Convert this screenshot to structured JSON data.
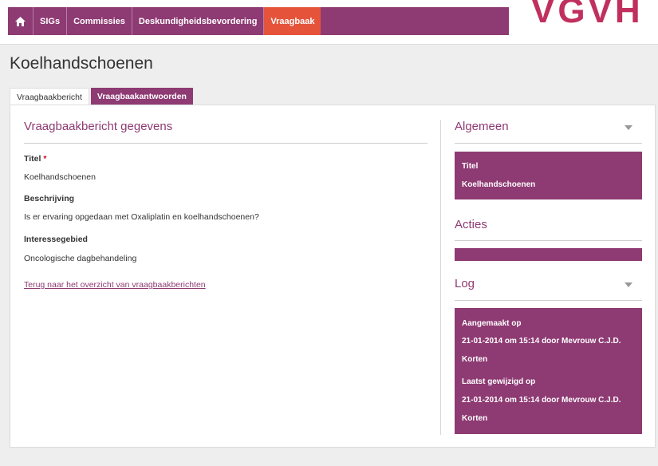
{
  "nav": {
    "items": [
      {
        "label": "SIGs"
      },
      {
        "label": "Commissies"
      },
      {
        "label": "Deskundigheidsbevordering"
      },
      {
        "label": "Vraagbaak"
      }
    ]
  },
  "logo": {
    "text": "VGVH"
  },
  "page": {
    "title": "Koelhandschoenen"
  },
  "tabs": [
    {
      "label": "Vraagbaakbericht"
    },
    {
      "label": "Vraagbaakantwoorden"
    }
  ],
  "details": {
    "section_title": "Vraagbaakbericht gegevens",
    "titel_label": "Titel",
    "required_marker": "*",
    "titel_value": "Koelhandschoenen",
    "beschrijving_label": "Beschrijving",
    "beschrijving_value": "Is er ervaring opgedaan met Oxaliplatin en koelhandschoenen?",
    "interesse_label": "Interessegebied",
    "interesse_value": "Oncologische dagbehandeling",
    "back_link": "Terug naar het overzicht van vraagbaakberichten"
  },
  "sidebar": {
    "algemeen": {
      "title": "Algemeen",
      "label": "Titel",
      "value": "Koelhandschoenen"
    },
    "acties": {
      "title": "Acties"
    },
    "log": {
      "title": "Log",
      "created_label": "Aangemaakt op",
      "created_line1": "21-01-2014 om 15:14 door Mevrouw C.J.D.",
      "created_line2": "Korten",
      "modified_label": "Laatst gewijzigd op",
      "modified_line1": "21-01-2014 om 15:14 door Mevrouw C.J.D.",
      "modified_line2": "Korten"
    }
  },
  "colors": {
    "brand": "#8e3a73",
    "accent": "#e5543a",
    "logo": "#c0305e"
  },
  "icons": {
    "home": "home-icon",
    "chevron": "chevron-down-icon"
  }
}
